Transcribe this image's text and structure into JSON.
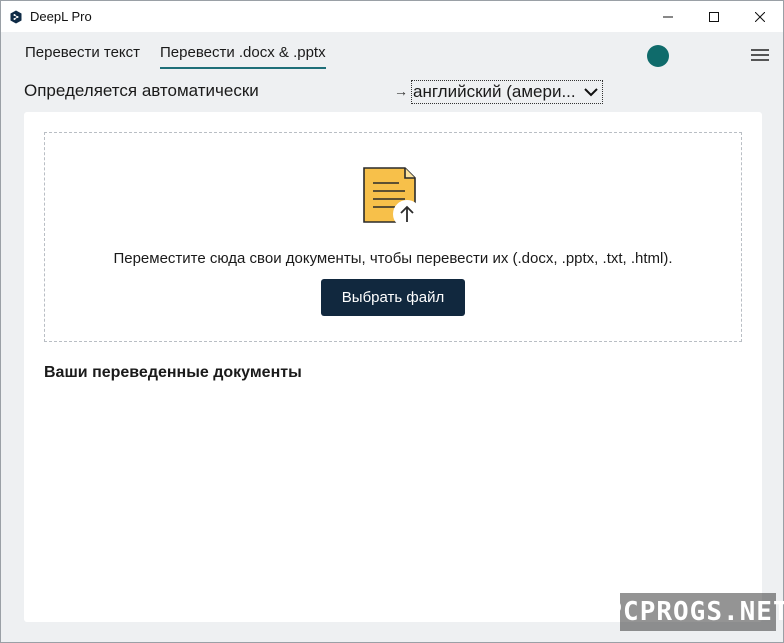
{
  "window": {
    "title": "DeepL Pro"
  },
  "tabs": [
    {
      "label": "Перевести текст",
      "active": false
    },
    {
      "label": "Перевести .docx & .pptx",
      "active": true
    }
  ],
  "languages": {
    "source": "Определяется автоматически",
    "arrow": "→",
    "target": "английский (амери..."
  },
  "dropzone": {
    "text": "Переместите сюда свои документы, чтобы перевести их (.docx, .pptx, .txt, .html).",
    "button_label": "Выбрать файл"
  },
  "translated_section": {
    "title": "Ваши переведенные документы"
  },
  "watermark": {
    "text": "PCPROGS.NET"
  },
  "colors": {
    "accent": "#1e6e78",
    "avatar": "#0f6b6b",
    "button": "#11283e",
    "doc_icon": "#f7c04a"
  },
  "icons": {
    "app": "deepl-logo-icon",
    "minimize": "minimize-icon",
    "maximize": "maximize-icon",
    "close": "close-icon",
    "menu": "hamburger-menu-icon",
    "dropdown": "chevron-down-icon",
    "document_upload": "document-upload-icon"
  }
}
